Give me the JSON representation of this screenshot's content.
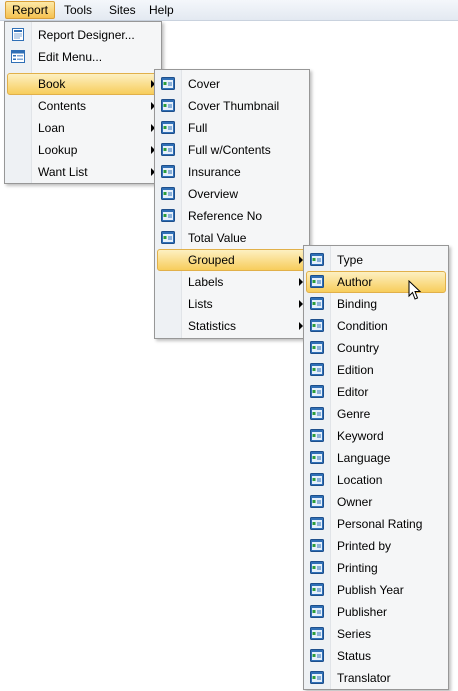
{
  "menubar": {
    "items": [
      {
        "label": "Report",
        "active": true
      },
      {
        "label": "Tools",
        "active": false
      },
      {
        "label": "Sites",
        "active": false
      },
      {
        "label": "Help",
        "active": false
      }
    ]
  },
  "report_menu": {
    "items": [
      {
        "label": "Report Designer...",
        "icon": "report-designer-icon"
      },
      {
        "label": "Edit Menu...",
        "icon": "edit-menu-icon"
      },
      {
        "label": "Book",
        "submenu": true,
        "highlighted": true
      },
      {
        "label": "Contents",
        "submenu": true
      },
      {
        "label": "Loan",
        "submenu": true
      },
      {
        "label": "Lookup",
        "submenu": true
      },
      {
        "label": "Want List",
        "submenu": true
      }
    ]
  },
  "book_menu": {
    "items": [
      {
        "label": "Cover",
        "icon": "report-icon"
      },
      {
        "label": "Cover Thumbnail",
        "icon": "report-icon"
      },
      {
        "label": "Full",
        "icon": "report-icon"
      },
      {
        "label": "Full w/Contents",
        "icon": "report-icon"
      },
      {
        "label": "Insurance",
        "icon": "report-icon"
      },
      {
        "label": "Overview",
        "icon": "report-icon"
      },
      {
        "label": "Reference No",
        "icon": "report-icon"
      },
      {
        "label": "Total Value",
        "icon": "report-icon"
      },
      {
        "label": "Grouped",
        "submenu": true,
        "highlighted": true
      },
      {
        "label": "Labels",
        "submenu": true
      },
      {
        "label": "Lists",
        "submenu": true
      },
      {
        "label": "Statistics",
        "submenu": true
      }
    ]
  },
  "grouped_menu": {
    "items": [
      {
        "label": "Type",
        "icon": "report-icon"
      },
      {
        "label": "Author",
        "icon": "report-icon",
        "highlighted": true
      },
      {
        "label": "Binding",
        "icon": "report-icon"
      },
      {
        "label": "Condition",
        "icon": "report-icon"
      },
      {
        "label": "Country",
        "icon": "report-icon"
      },
      {
        "label": "Edition",
        "icon": "report-icon"
      },
      {
        "label": "Editor",
        "icon": "report-icon"
      },
      {
        "label": "Genre",
        "icon": "report-icon"
      },
      {
        "label": "Keyword",
        "icon": "report-icon"
      },
      {
        "label": "Language",
        "icon": "report-icon"
      },
      {
        "label": "Location",
        "icon": "report-icon"
      },
      {
        "label": "Owner",
        "icon": "report-icon"
      },
      {
        "label": "Personal Rating",
        "icon": "report-icon"
      },
      {
        "label": "Printed by",
        "icon": "report-icon"
      },
      {
        "label": "Printing",
        "icon": "report-icon"
      },
      {
        "label": "Publish Year",
        "icon": "report-icon"
      },
      {
        "label": "Publisher",
        "icon": "report-icon"
      },
      {
        "label": "Series",
        "icon": "report-icon"
      },
      {
        "label": "Status",
        "icon": "report-icon"
      },
      {
        "label": "Translator",
        "icon": "report-icon"
      }
    ]
  },
  "colors": {
    "highlight_top": "#fdf0c2",
    "highlight_bottom": "#f7cd5c",
    "menu_bg": "#f5f6f7",
    "icon_blue": "#2f6fb6"
  }
}
